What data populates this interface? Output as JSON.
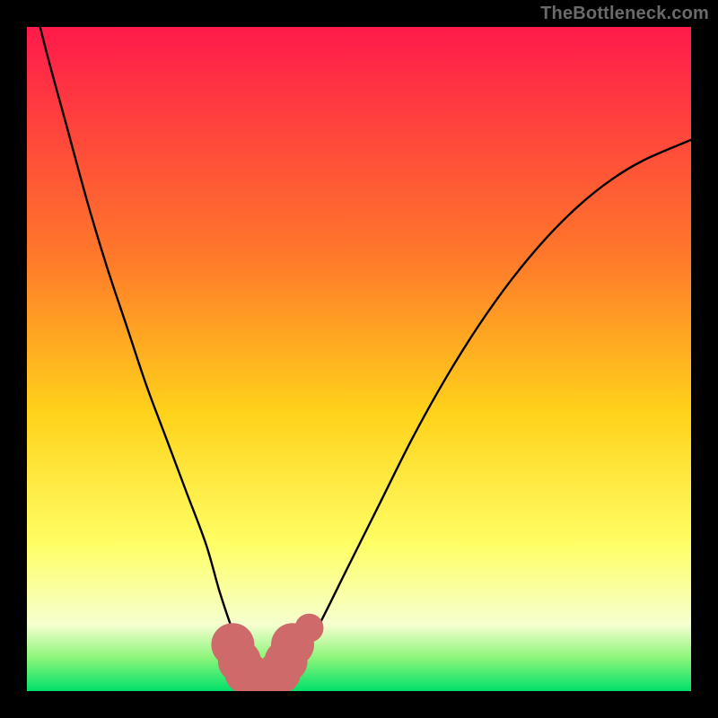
{
  "watermark": "TheBottleneck.com",
  "colors": {
    "frame": "#000000",
    "grad_top": "#ff1a4b",
    "grad_mid_upper": "#ff7a2a",
    "grad_mid": "#ffd21a",
    "grad_lower": "#ffff66",
    "grad_pale": "#f6ffd0",
    "grad_green_soft": "#8bf57a",
    "grad_green": "#00e06a",
    "curve": "#000000",
    "points": "#cf6a6a"
  },
  "chart_data": {
    "type": "line",
    "title": "",
    "xlabel": "",
    "ylabel": "",
    "xlim": [
      0,
      100
    ],
    "ylim": [
      0,
      100
    ],
    "series": [
      {
        "name": "bottleneck-curve",
        "x": [
          0,
          3,
          6,
          9,
          12,
          15,
          18,
          21,
          24,
          27,
          29,
          31,
          32.5,
          34,
          35.5,
          37,
          39,
          41,
          44,
          48,
          53,
          58,
          63,
          68,
          73,
          78,
          83,
          88,
          93,
          100
        ],
        "y": [
          108,
          96,
          85,
          74,
          64,
          55,
          46,
          38,
          30,
          22,
          15,
          9,
          5,
          2.5,
          1.5,
          1.5,
          2.5,
          5,
          10,
          18,
          28,
          38,
          47,
          55,
          62,
          68,
          73,
          77,
          80,
          83
        ]
      }
    ],
    "points": {
      "name": "highlighted-points",
      "items": [
        {
          "x": 31.0,
          "y": 7.0,
          "r": 1.8
        },
        {
          "x": 32.0,
          "y": 4.5,
          "r": 1.8
        },
        {
          "x": 33.0,
          "y": 2.8,
          "r": 1.8
        },
        {
          "x": 34.0,
          "y": 1.8,
          "r": 1.8
        },
        {
          "x": 35.0,
          "y": 1.5,
          "r": 1.8
        },
        {
          "x": 36.0,
          "y": 1.5,
          "r": 1.8
        },
        {
          "x": 37.0,
          "y": 1.8,
          "r": 1.8
        },
        {
          "x": 38.0,
          "y": 2.8,
          "r": 1.8
        },
        {
          "x": 39.0,
          "y": 4.5,
          "r": 1.8
        },
        {
          "x": 40.0,
          "y": 7.0,
          "r": 1.8
        },
        {
          "x": 42.5,
          "y": 9.5,
          "r": 1.2
        }
      ]
    }
  }
}
